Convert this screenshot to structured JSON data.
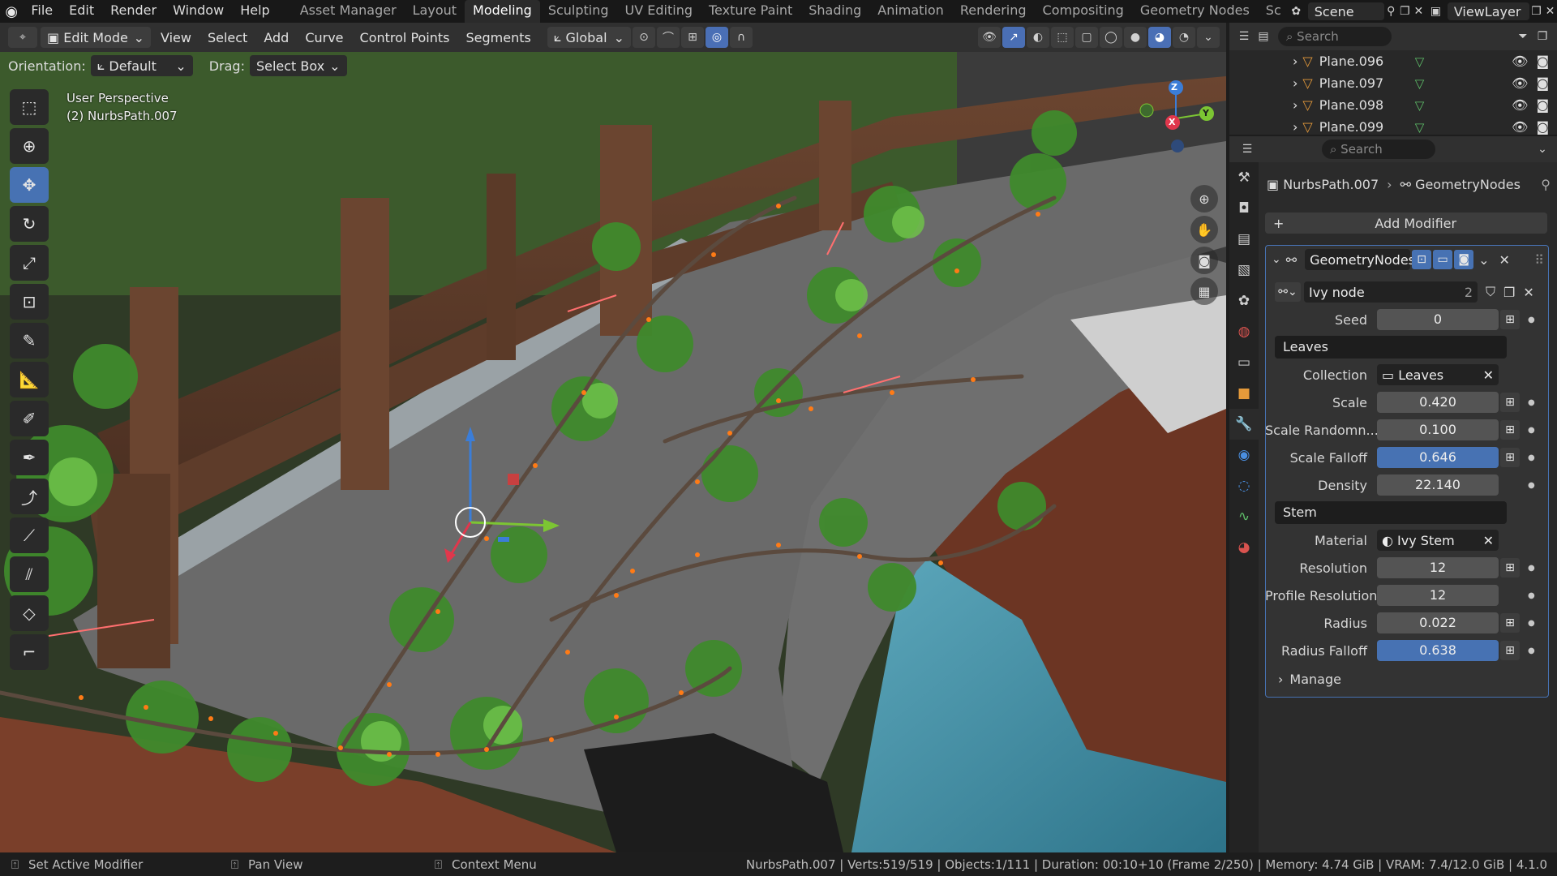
{
  "menubar": {
    "items": [
      "File",
      "Edit",
      "Render",
      "Window",
      "Help"
    ],
    "workspaces": [
      "Asset Manager",
      "Layout",
      "Modeling",
      "Sculpting",
      "UV Editing",
      "Texture Paint",
      "Shading",
      "Animation",
      "Rendering",
      "Compositing",
      "Geometry Nodes",
      "Sc"
    ],
    "active_workspace": "Modeling",
    "scene": "Scene",
    "view_layer": "ViewLayer"
  },
  "viewport_header": {
    "mode": "Edit Mode",
    "menus": [
      "View",
      "Select",
      "Add",
      "Curve",
      "Control Points",
      "Segments"
    ],
    "transform_orientation": "Global",
    "orientation_label": "Orientation:",
    "orientation_value": "Default",
    "drag_label": "Drag:",
    "drag_value": "Select Box"
  },
  "viewport": {
    "perspective": "User Perspective",
    "object": "(2) NurbsPath.007",
    "axes": {
      "x": "X",
      "y": "Y",
      "z": "Z"
    }
  },
  "outliner": {
    "search_placeholder": "Search",
    "rows": [
      "Plane.096",
      "Plane.097",
      "Plane.098",
      "Plane.099"
    ]
  },
  "properties": {
    "search_placeholder": "Search",
    "breadcrumb_object": "NurbsPath.007",
    "breadcrumb_modifier": "GeometryNodes",
    "add_modifier": "Add Modifier",
    "modifier_name": "GeometryNodes",
    "node_group": "Ivy node",
    "node_group_users": "2",
    "seed_label": "Seed",
    "seed_value": "0",
    "leaves_section": "Leaves",
    "collection_label": "Collection",
    "collection_value": "Leaves",
    "scale_label": "Scale",
    "scale_value": "0.420",
    "scale_random_label": "Scale Randomn...",
    "scale_random_value": "0.100",
    "scale_falloff_label": "Scale Falloff",
    "scale_falloff_value": "0.646",
    "density_label": "Density",
    "density_value": "22.140",
    "stem_section": "Stem",
    "material_label": "Material",
    "material_value": "Ivy Stem",
    "resolution_label": "Resolution",
    "resolution_value": "12",
    "profile_resolution_label": "Profile Resolution",
    "profile_resolution_value": "12",
    "radius_label": "Radius",
    "radius_value": "0.022",
    "radius_falloff_label": "Radius Falloff",
    "radius_falloff_value": "0.638",
    "manage_label": "Manage"
  },
  "statusbar": {
    "hint1": "Set Active Modifier",
    "hint2": "Pan View",
    "hint3": "Context Menu",
    "stats": "NurbsPath.007 | Verts:519/519 | Objects:1/111 | Duration: 00:10+10 (Frame 2/250) | Memory: 4.74 GiB | VRAM: 7.4/12.0 GiB | 4.1.0"
  },
  "colors": {
    "accent": "#4772b3",
    "orange": "#e59a3a",
    "x_axis": "#e0374c",
    "y_axis": "#7cc533",
    "z_axis": "#3b7dd8"
  }
}
